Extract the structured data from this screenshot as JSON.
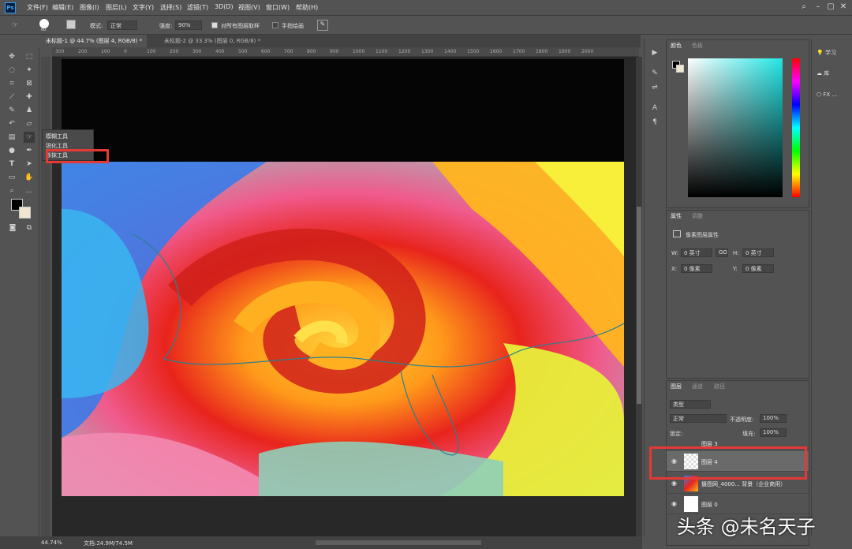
{
  "menubar": {
    "items": [
      "文件(F)",
      "编辑(E)",
      "图像(I)",
      "图层(L)",
      "文字(Y)",
      "选择(S)",
      "滤镜(T)",
      "3D(D)",
      "视图(V)",
      "窗口(W)",
      "帮助(H)"
    ]
  },
  "options": {
    "mode_label": "模式:",
    "mode_value": "正常",
    "strength_label": "强度:",
    "strength_value": "90%",
    "sample_all": "对所有图层取样",
    "finger_paint": "手指绘画",
    "brush_size": "60"
  },
  "tabs": [
    {
      "label": "未标题-1 @ 44.7% (图层 4, RGB/8) *"
    },
    {
      "label": "未标题-2 @ 33.3% (图层 0, RGB/8) *"
    }
  ],
  "ruler_ticks": [
    "300",
    "200",
    "100",
    "0",
    "100",
    "200",
    "300",
    "400",
    "500",
    "600",
    "700",
    "800",
    "900",
    "1000",
    "1100",
    "1200",
    "1300",
    "1400",
    "1500",
    "1600",
    "1700",
    "1800",
    "1900",
    "2000"
  ],
  "flyout": {
    "items": [
      "模糊工具",
      "锐化工具",
      "涂抹工具"
    ]
  },
  "status": {
    "zoom": "44.74%",
    "doc": "文档:24.9M/74.5M"
  },
  "color_panel": {
    "tabs": [
      "颜色",
      "色板"
    ]
  },
  "properties_panel": {
    "tabs": [
      "属性",
      "调整"
    ],
    "title": "像素图层属性",
    "w_label": "W:",
    "w_value": "0 英寸",
    "h_label": "H:",
    "h_value": "0 英寸",
    "x_label": "X:",
    "x_value": "0 像素",
    "y_label": "Y:",
    "y_value": "0 像素",
    "link": "GO"
  },
  "layers_panel": {
    "tabs": [
      "图层",
      "通道",
      "路径"
    ],
    "filter": "类型",
    "blend": "正常",
    "opacity_label": "不透明度:",
    "opacity_value": "100%",
    "lock_label": "锁定:",
    "fill_label": "填充:",
    "fill_value": "100%",
    "layers": [
      {
        "name": "图层 3"
      },
      {
        "name": "图层 4"
      },
      {
        "name": "摄图网_4000... 背景（企业商用）"
      },
      {
        "name": "图层 0"
      }
    ]
  },
  "right_icons": [
    "学习",
    "库",
    "FX ..."
  ],
  "watermark": "头条 @未名天子",
  "colors": {
    "highlight": "#e53935",
    "panel_bg": "#535353",
    "canvas_bg": "#282828"
  }
}
